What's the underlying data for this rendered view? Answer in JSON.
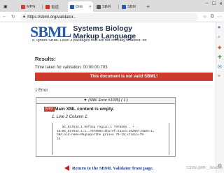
{
  "tabs": [
    {
      "title": "MPN",
      "favicon_color": "#d04040"
    },
    {
      "title": "有道",
      "favicon_color": "#d93025"
    },
    {
      "title": "Onli",
      "favicon_color": "#2a5aa8"
    },
    {
      "title": "SBM",
      "favicon_color": "#555555"
    },
    {
      "title": "SBM",
      "favicon_color": "#2a5aa8"
    }
  ],
  "address": {
    "url": "https://sbml.org/validator..."
  },
  "logo": {
    "mark": "SBML",
    "line1": "Systems Biology",
    "line2": "Markup Language"
  },
  "page": {
    "truncated_line": "8. Ignore SBML Level 3 packages that are not officially finalized: on",
    "results_heading": "Results:",
    "time_text": "Time taken for validation: 00:00:00.703",
    "banner_text": "This document is not valid SBML!",
    "error_count_text": "1 Error",
    "error": {
      "header": "▼ (XML Error #1035) ( 1 )",
      "badge": "Error",
      "title": "Main XML content is empty.",
      "item": "Line 2 Column 1:",
      "code": "   NC_017844.1 RefSeq region 1 7978604 . + .\nID=NC_017844.1:1..7978604;Dbxref=taxon:262507;Name=1;\nDNA;old-name=Magnaporthe grisea 70-15;strain=70-\n15"
    },
    "return_link": "Return to the SBML Validator front page.",
    "watermark": "CSDN @MF__WinGen"
  }
}
